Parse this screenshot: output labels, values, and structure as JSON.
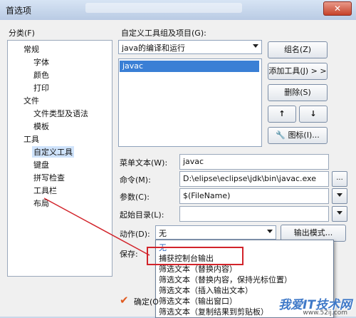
{
  "window": {
    "title": "首选项"
  },
  "categories": {
    "label": "分类(F)",
    "items": [
      {
        "label": "常规",
        "indent": 0
      },
      {
        "label": "字体",
        "indent": 1
      },
      {
        "label": "颜色",
        "indent": 1
      },
      {
        "label": "打印",
        "indent": 1
      },
      {
        "label": "文件",
        "indent": 0
      },
      {
        "label": "文件类型及语法",
        "indent": 1
      },
      {
        "label": "模板",
        "indent": 1
      },
      {
        "label": "工具",
        "indent": 0
      },
      {
        "label": "自定义工具",
        "indent": 1,
        "selected": true
      },
      {
        "label": "键盘",
        "indent": 1
      },
      {
        "label": "拼写检查",
        "indent": 1
      },
      {
        "label": "工具栏",
        "indent": 1
      },
      {
        "label": "布局",
        "indent": 1
      }
    ]
  },
  "tools": {
    "group_label": "自定义工具组及项目(G):",
    "group_value": "java的编译和运行",
    "list_items": [
      "javac"
    ],
    "buttons": {
      "group": "组名(Z)",
      "add": "添加工具(J) > >",
      "delete": "删除(S)",
      "up": "↑",
      "down": "↓",
      "icon": "图标(I)..."
    }
  },
  "form": {
    "menu_text_label": "菜单文本(W):",
    "menu_text_value": "javac",
    "command_label": "命令(M):",
    "command_value": "D:\\elipse\\eclipse\\jdk\\bin\\javac.exe",
    "command_browse": "...",
    "params_label": "参数(C):",
    "params_value": "$(FileName)",
    "startdir_label": "起始目录(L):",
    "startdir_value": "",
    "action_label": "动作(D):",
    "action_value": "无",
    "output_mode_button": "输出模式...",
    "save_label": "保存:"
  },
  "action_dropdown": {
    "options": [
      "无",
      "捕获控制台输出",
      "筛选文本（替换内容）",
      "筛选文本（替换内容，保持光标位置）",
      "筛选文本（插入输出文本）",
      "筛选文本（输出窗口）",
      "筛选文本（复制结果到剪贴板）"
    ],
    "highlighted": 1
  },
  "footer": {
    "ok_label": "确定(O",
    "check_icon": "check-icon"
  },
  "watermark": {
    "text": "我爱IT技术网",
    "url": "www.52ij.com"
  },
  "colors": {
    "annotation": "#d2232a",
    "selection": "#3a7fd5"
  }
}
